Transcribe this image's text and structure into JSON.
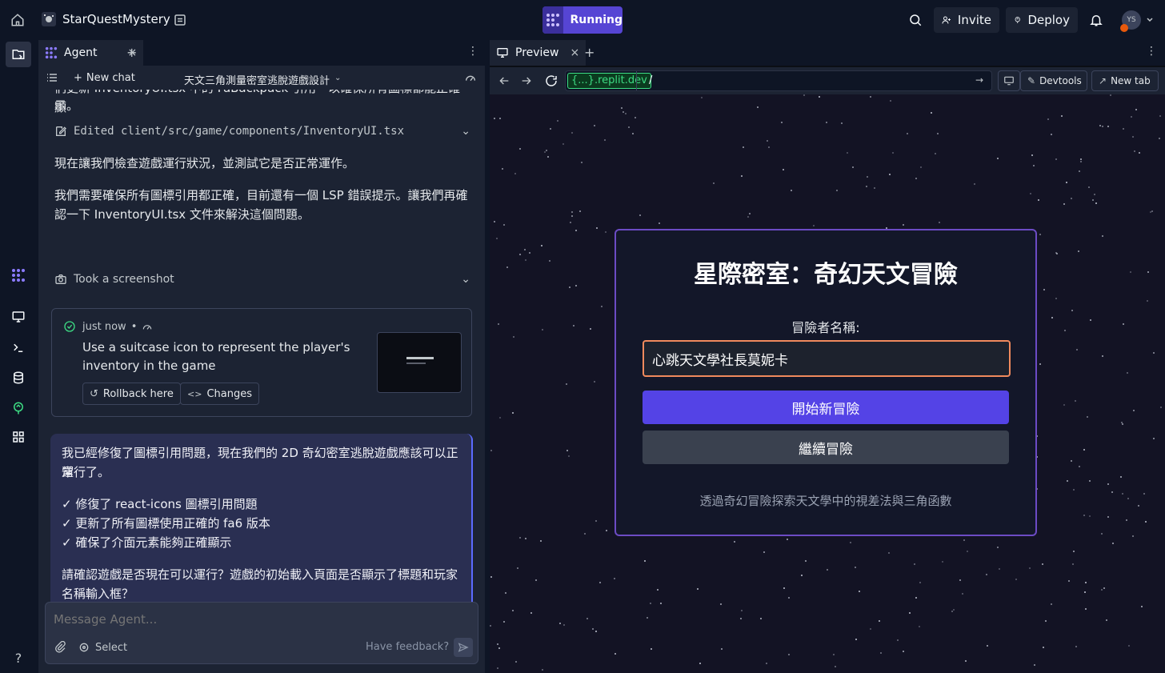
{
  "topbar": {
    "repl_name": "StarQuestMystery",
    "run_label": "Running",
    "invite_label": "Invite",
    "deploy_label": "Deploy",
    "avatar_initials": "YS"
  },
  "agent_panel": {
    "tab_label": "Agent",
    "new_chat_label": "New chat",
    "chat_title": "天文三角測量密室逃脫遊戲設計",
    "cut_text": "们更新 InventoryUI.tsx 中的 FaBackpack 引用一以確保所有圖標都能正確顯",
    "cut_text_tail": "示。",
    "edited_label": "Edited client/src/game/components/InventoryUI.tsx",
    "msg1": "現在讓我們檢查遊戲運行狀況，並測試它是否正常運作。",
    "msg2_line1": "我們需要確保所有圖標引用都正確，目前還有一個 LSP 錯誤提示。讓我們再確",
    "msg2_line2": "認一下 InventoryUI.tsx 文件來解決這個問題。",
    "screenshot_label": "Took a screenshot",
    "checkpoint": {
      "time": "just now",
      "desc_line1": "Use a suitcase icon to represent the player's",
      "desc_line2": "inventory in the game",
      "rollback_label": "Rollback here",
      "changes_label": "Changes"
    },
    "reply": {
      "line1": "我已經修復了圖標引用問題，現在我們的 2D 奇幻密室逃脫遊戲應該可以正常",
      "line2": "運行了。",
      "bullet1": "✓ 修復了 react-icons 圖標引用問題",
      "bullet2": "✓ 更新了所有圖標使用正確的 fa6 版本",
      "bullet3": "✓ 確保了介面元素能夠正確顯示",
      "q_line1": "請確認遊戲是否現在可以運行？遊戲的初始載入頁面是否顯示了標題和玩家",
      "q_line2": "名稱輸入框？"
    },
    "composer": {
      "placeholder": "Message Agent...",
      "select_label": "Select",
      "feedback_label": "Have feedback?"
    }
  },
  "preview_panel": {
    "tab_label": "Preview",
    "url_domain": "{...}.replit.dev",
    "url_path": "/",
    "devtools_label": "Devtools",
    "new_tab_label": "New tab"
  },
  "game": {
    "title": "星際密室：奇幻天文冒險",
    "name_label": "冒險者名稱:",
    "name_value": "心跳天文學社長莫妮卡",
    "start_button": "開始新冒險",
    "continue_button": "繼續冒險",
    "footer": "透過奇幻冒險探索天文學中的視差法與三角函數"
  },
  "colors": {
    "accent": "#5645d4",
    "card_border": "#6c4bc4",
    "input_border": "#f08a5d",
    "start_button": "#5443e6",
    "continue_button": "#3a414f"
  }
}
